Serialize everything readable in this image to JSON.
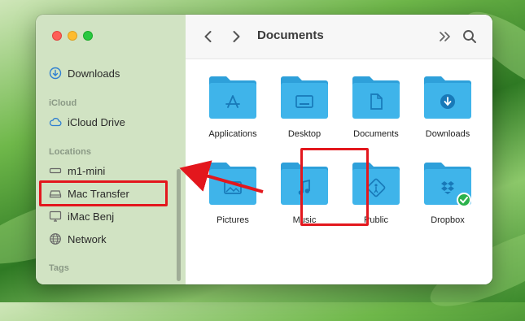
{
  "window": {
    "title": "Documents",
    "traffic_lights": [
      "close",
      "minimize",
      "zoom"
    ]
  },
  "sidebar": {
    "favorites": [
      {
        "label": "Downloads",
        "icon": "downloads-icon"
      }
    ],
    "icloud_heading": "iCloud",
    "icloud": [
      {
        "label": "iCloud Drive",
        "icon": "cloud-icon"
      }
    ],
    "locations_heading": "Locations",
    "locations": [
      {
        "label": "m1-mini",
        "icon": "mac-mini-icon"
      },
      {
        "label": "Mac Transfer",
        "icon": "external-drive-icon",
        "highlighted": true
      },
      {
        "label": "iMac Benj",
        "icon": "display-icon"
      },
      {
        "label": "Network",
        "icon": "globe-icon"
      }
    ],
    "tags_heading": "Tags"
  },
  "toolbar": {
    "back_icon": "chevron-left-icon",
    "forward_icon": "chevron-right-icon",
    "more_icon": "double-chevron-right-icon",
    "search_icon": "search-icon"
  },
  "folders": [
    {
      "label": "Applications",
      "glyph": "app-store-icon"
    },
    {
      "label": "Desktop",
      "glyph": "desktop-icon"
    },
    {
      "label": "Documents",
      "glyph": "document-icon"
    },
    {
      "label": "Downloads",
      "glyph": "download-arrow-icon"
    },
    {
      "label": "Pictures",
      "glyph": "picture-icon"
    },
    {
      "label": "Music",
      "glyph": "music-note-icon",
      "highlighted": true
    },
    {
      "label": "Public",
      "glyph": "public-icon"
    },
    {
      "label": "Dropbox",
      "glyph": "dropbox-icon",
      "badge": "synced-check"
    }
  ],
  "colors": {
    "folder": "#3fb4ea",
    "folder_tab": "#2ea0da",
    "highlight": "#e3171d",
    "sidebar_bg": "#cde1be",
    "badge_green": "#2bb24c"
  }
}
